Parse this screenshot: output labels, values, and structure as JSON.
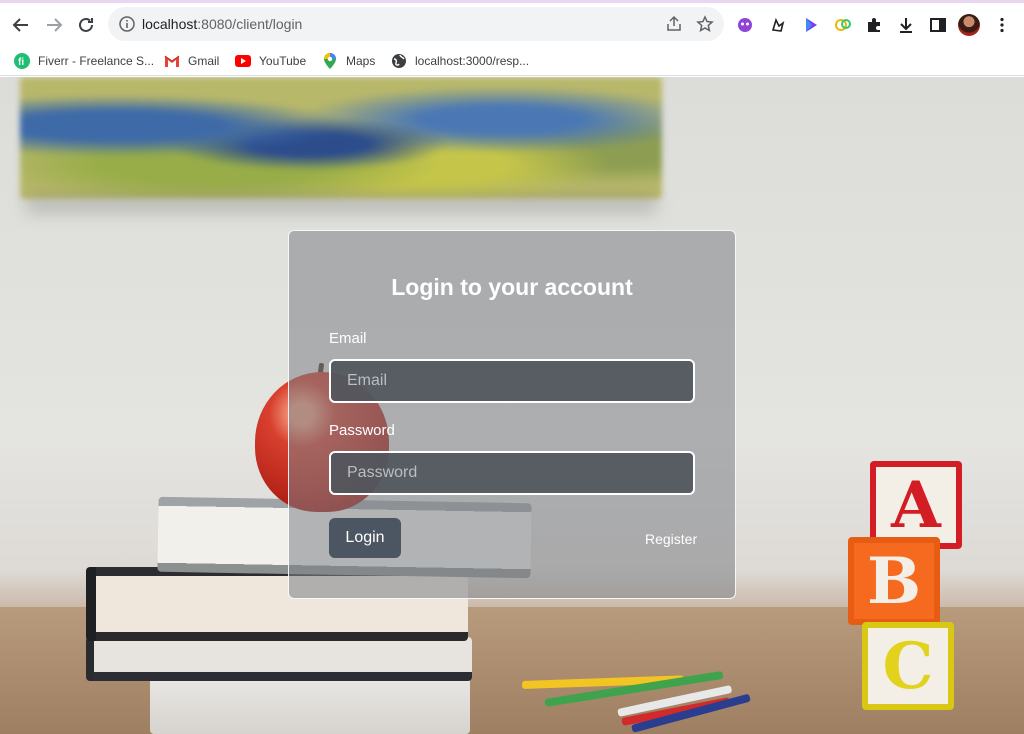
{
  "browser": {
    "url_host": "localhost",
    "url_rest": ":8080/client/login",
    "bookmarks": [
      {
        "label": "Fiverr - Freelance S...",
        "icon": "fiverr-icon"
      },
      {
        "label": "Gmail",
        "icon": "gmail-icon"
      },
      {
        "label": "YouTube",
        "icon": "youtube-icon"
      },
      {
        "label": "Maps",
        "icon": "maps-icon"
      },
      {
        "label": "localhost:3000/resp...",
        "icon": "globe-icon"
      }
    ]
  },
  "login": {
    "title": "Login to your account",
    "email_label": "Email",
    "email_placeholder": "Email",
    "email_value": "",
    "password_label": "Password",
    "password_placeholder": "Password",
    "password_value": "",
    "submit_label": "Login",
    "register_label": "Register"
  },
  "colors": {
    "card_border": "#ffffff",
    "input_bg": "#50565c",
    "button_bg": "#4c5562"
  }
}
